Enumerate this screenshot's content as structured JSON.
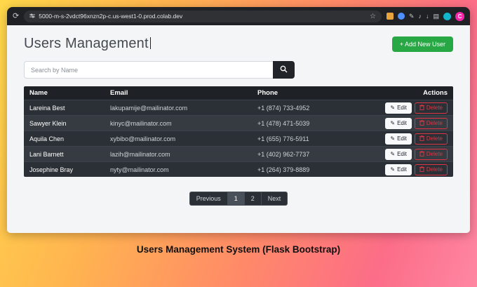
{
  "browser": {
    "url": "5000-m-s-2vdct96xnzn2p-c.us-west1-0.prod.colab.dev",
    "profile_letter": "C"
  },
  "icons": {
    "reload": "⟳",
    "bookmark": "☆",
    "pencil": "✎",
    "note": "♪",
    "download": "↓",
    "book": "▤"
  },
  "page": {
    "title": "Users Management",
    "add_button_label": "+ Add New User",
    "search_placeholder": "Search by Name",
    "table": {
      "headers": [
        "Name",
        "Email",
        "Phone",
        "Actions"
      ],
      "rows": [
        {
          "name": "Lareina Best",
          "email": "lakupamije@mailinator.com",
          "phone": "+1 (874) 733-4952"
        },
        {
          "name": "Sawyer Klein",
          "email": "kinyc@mailinator.com",
          "phone": "+1 (478) 471-5039"
        },
        {
          "name": "Aquila Chen",
          "email": "xybibo@mailinator.com",
          "phone": "+1 (655) 776-5911"
        },
        {
          "name": "Lani Barnett",
          "email": "lazih@mailinator.com",
          "phone": "+1 (402) 962-7737"
        },
        {
          "name": "Josephine Bray",
          "email": "nyty@mailinator.com",
          "phone": "+1 (264) 379-8889"
        }
      ],
      "edit_label": "Edit",
      "delete_label": "Delete"
    },
    "pagination": [
      "Previous",
      "1",
      "2",
      "Next"
    ],
    "caption": "Users Management System (Flask Bootstrap)"
  },
  "colors": {
    "add_button_green": "#28a745",
    "delete_red": "#dc3545",
    "table_dark": "#212529",
    "profile_pink": "#f626a8",
    "frame_yellow": "#ffd84a",
    "frame_pink": "#fc6d88"
  }
}
